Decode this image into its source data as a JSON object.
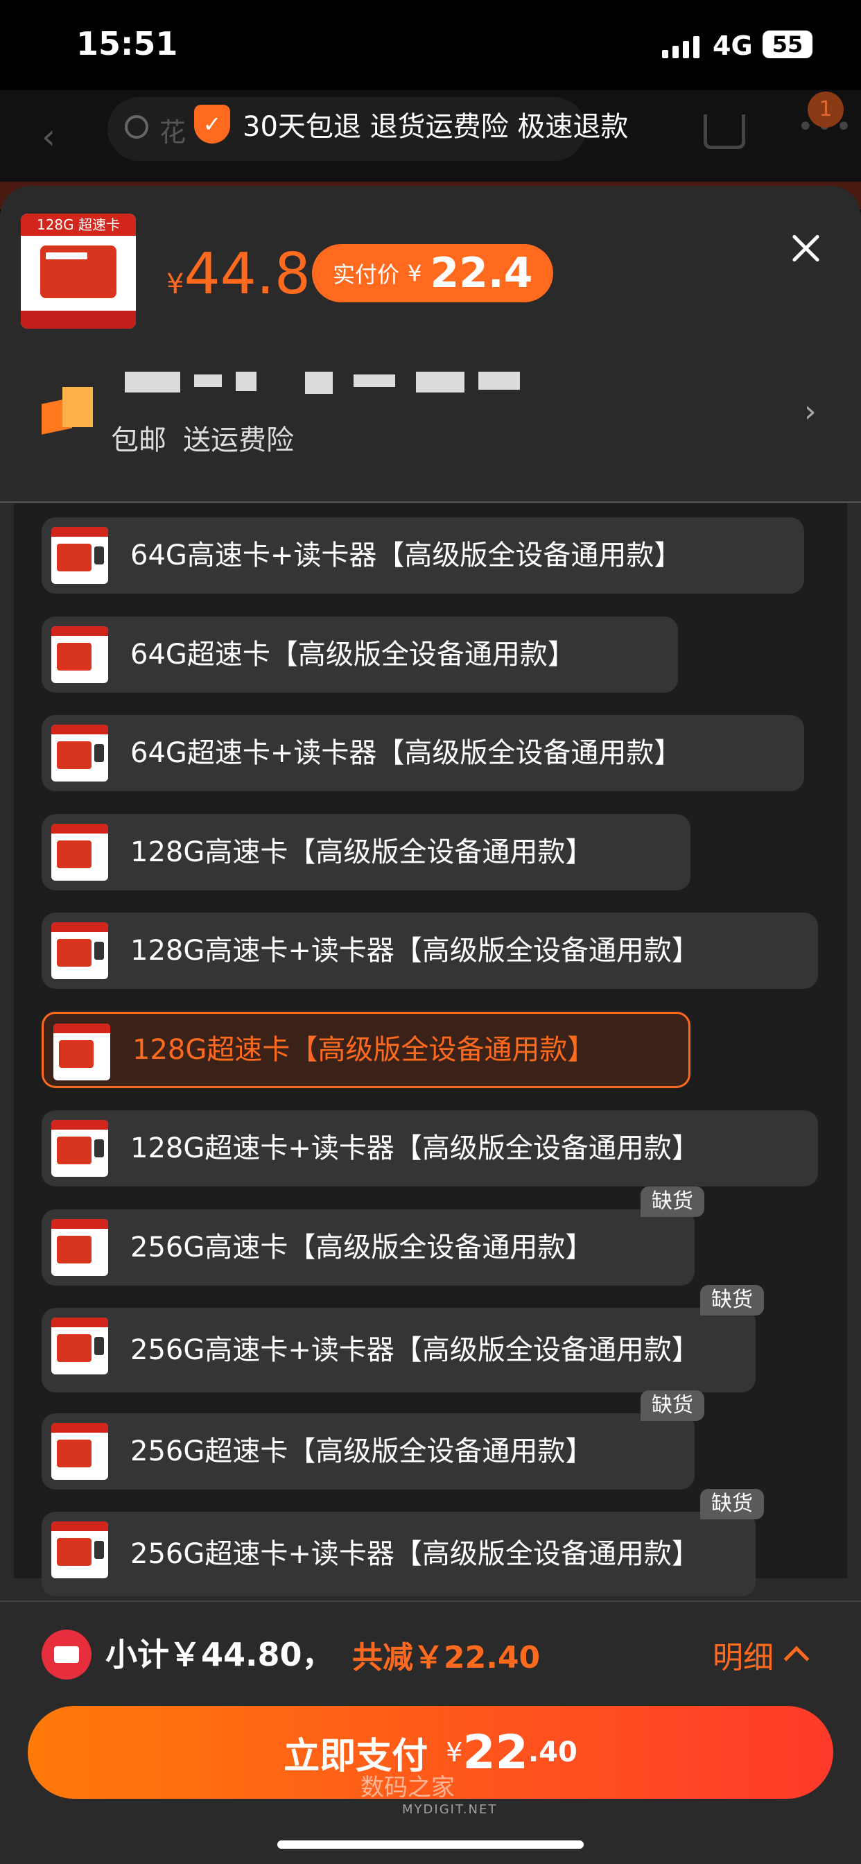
{
  "status_bar": {
    "time": "15:51",
    "network": "4G",
    "battery": "55"
  },
  "header": {
    "search_placeholder": "花",
    "promo_text": "30天包退 退货运费险 极速退款",
    "cart_badge": "1"
  },
  "product": {
    "thumb_label": "128G 超速卡",
    "currency": "¥",
    "price": "44.8",
    "actual_label": "实付价",
    "actual_price": "22.4"
  },
  "shop": {
    "tags": [
      "包邮",
      "送运费险"
    ]
  },
  "options": [
    {
      "label": "64G高速卡+读卡器【高级版全设备通用款】",
      "selected": false,
      "badge": ""
    },
    {
      "label": "64G超速卡【高级版全设备通用款】",
      "selected": false,
      "badge": ""
    },
    {
      "label": "64G超速卡+读卡器【高级版全设备通用款】",
      "selected": false,
      "badge": ""
    },
    {
      "label": "128G高速卡【高级版全设备通用款】",
      "selected": false,
      "badge": ""
    },
    {
      "label": "128G高速卡+读卡器【高级版全设备通用款】",
      "selected": false,
      "badge": ""
    },
    {
      "label": "128G超速卡【高级版全设备通用款】",
      "selected": true,
      "badge": ""
    },
    {
      "label": "128G超速卡+读卡器【高级版全设备通用款】",
      "selected": false,
      "badge": ""
    },
    {
      "label": "256G高速卡【高级版全设备通用款】",
      "selected": false,
      "badge": "缺货"
    },
    {
      "label": "256G高速卡+读卡器【高级版全设备通用款】",
      "selected": false,
      "badge": "缺货"
    },
    {
      "label": "256G超速卡【高级版全设备通用款】",
      "selected": false,
      "badge": "缺货"
    },
    {
      "label": "256G超速卡+读卡器【高级版全设备通用款】",
      "selected": false,
      "badge": "缺货"
    }
  ],
  "footer": {
    "subtotal": "小计￥44.80，",
    "saving": "共减￥22.40",
    "detail": "明细",
    "pay_label": "立即支付",
    "pay_currency": "¥",
    "pay_int": "22",
    "pay_dec": ".40",
    "watermark": "数码之家",
    "watermark_sub": "MYDIGIT.NET"
  },
  "colors": {
    "accent": "#ff6a1f",
    "sheet_bg": "#2a2a2a",
    "option_bg": "#353535"
  }
}
